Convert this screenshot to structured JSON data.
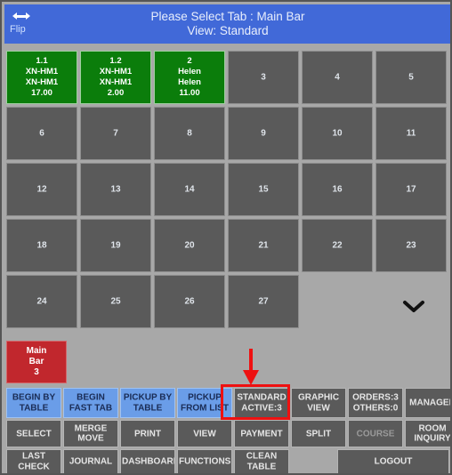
{
  "header": {
    "title_line1": "Please Select Tab : Main Bar",
    "title_line2": "View: Standard",
    "flip_label": "Flip",
    "flip_icon": "horizontal-double-arrow-icon",
    "bg_color": "#4169d8"
  },
  "grid": {
    "columns": 6,
    "occupied_color": "#0b7d0b",
    "empty_color": "#5a5a5a",
    "cells": [
      {
        "number": "1.1",
        "state": "occupied",
        "lines": [
          "1.1",
          "XN-HM1",
          "XN-HM1",
          "17.00"
        ]
      },
      {
        "number": "1.2",
        "state": "occupied",
        "lines": [
          "1.2",
          "XN-HM1",
          "XN-HM1",
          "2.00"
        ]
      },
      {
        "number": "2",
        "state": "occupied",
        "lines": [
          "2",
          "Helen",
          "Helen",
          "11.00"
        ]
      },
      {
        "number": "3",
        "state": "empty"
      },
      {
        "number": "4",
        "state": "empty"
      },
      {
        "number": "5",
        "state": "empty"
      },
      {
        "number": "6",
        "state": "empty"
      },
      {
        "number": "7",
        "state": "empty"
      },
      {
        "number": "8",
        "state": "empty"
      },
      {
        "number": "9",
        "state": "empty"
      },
      {
        "number": "10",
        "state": "empty"
      },
      {
        "number": "11",
        "state": "empty"
      },
      {
        "number": "12",
        "state": "empty"
      },
      {
        "number": "13",
        "state": "empty"
      },
      {
        "number": "14",
        "state": "empty"
      },
      {
        "number": "15",
        "state": "empty"
      },
      {
        "number": "16",
        "state": "empty"
      },
      {
        "number": "17",
        "state": "empty"
      },
      {
        "number": "18",
        "state": "empty"
      },
      {
        "number": "19",
        "state": "empty"
      },
      {
        "number": "20",
        "state": "empty"
      },
      {
        "number": "21",
        "state": "empty"
      },
      {
        "number": "22",
        "state": "empty"
      },
      {
        "number": "23",
        "state": "empty"
      },
      {
        "number": "24",
        "state": "empty"
      },
      {
        "number": "25",
        "state": "empty"
      },
      {
        "number": "26",
        "state": "empty"
      },
      {
        "number": "27",
        "state": "empty"
      }
    ],
    "scroll_down_icon": "chevron-down-icon"
  },
  "tab_strip": {
    "tabs": [
      {
        "lines": [
          "Main",
          "Bar",
          "3"
        ],
        "color": "#c1272d",
        "active": true
      }
    ]
  },
  "button_bar": {
    "row1": [
      {
        "lines": [
          "BEGIN BY",
          "TABLE"
        ],
        "style": "blue"
      },
      {
        "lines": [
          "BEGIN",
          "FAST TAB"
        ],
        "style": "blue"
      },
      {
        "lines": [
          "PICKUP BY",
          "TABLE"
        ],
        "style": "blue"
      },
      {
        "lines": [
          "PICKUP",
          "FROM LIST"
        ],
        "style": "blue"
      },
      {
        "lines": [
          "STANDARD",
          "ACTIVE:3"
        ],
        "style": "gray",
        "highlighted": true
      },
      {
        "lines": [
          "GRAPHIC",
          "VIEW"
        ],
        "style": "gray"
      },
      {
        "lines": [
          "ORDERS:3",
          "OTHERS:0"
        ],
        "style": "gray"
      },
      {
        "lines": [
          "MANAGER"
        ],
        "style": "gray"
      }
    ],
    "row2": [
      {
        "lines": [
          "SELECT"
        ],
        "style": "gray"
      },
      {
        "lines": [
          "MERGE",
          "MOVE"
        ],
        "style": "gray"
      },
      {
        "lines": [
          "PRINT"
        ],
        "style": "gray"
      },
      {
        "lines": [
          "VIEW"
        ],
        "style": "gray"
      },
      {
        "lines": [
          "PAYMENT"
        ],
        "style": "gray"
      },
      {
        "lines": [
          "SPLIT"
        ],
        "style": "gray"
      },
      {
        "lines": [
          "COURSE"
        ],
        "style": "gray-dim"
      },
      {
        "lines": [
          "ROOM",
          "INQUIRY"
        ],
        "style": "gray"
      }
    ],
    "row3": [
      {
        "lines": [
          "LAST CHECK"
        ],
        "style": "gray"
      },
      {
        "lines": [
          "JOURNAL"
        ],
        "style": "gray"
      },
      {
        "lines": [
          "DASHBOARD"
        ],
        "style": "gray"
      },
      {
        "lines": [
          "FUNCTIONS"
        ],
        "style": "gray"
      },
      {
        "lines": [
          "CLEAN",
          "TABLE"
        ],
        "style": "gray"
      },
      {
        "lines": [
          "LOGOUT"
        ],
        "style": "gray",
        "wide": true
      }
    ]
  },
  "annotation": {
    "arrow_color": "#ee1111",
    "highlight_color": "#ee1111",
    "points_at": "STANDARD ACTIVE:3"
  }
}
